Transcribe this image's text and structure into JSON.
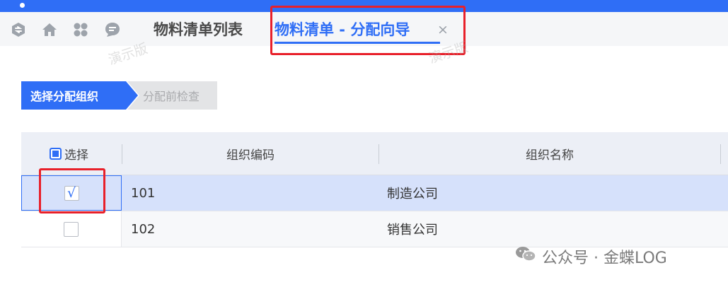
{
  "header": {
    "icons": [
      "refresh-icon",
      "home-icon",
      "apps-icon",
      "chat-icon"
    ],
    "tabs": [
      {
        "label": "物料清单列表",
        "active": false
      },
      {
        "label": "物料清单 - 分配向导",
        "active": true,
        "closable": true,
        "close_label": "×"
      }
    ]
  },
  "watermark": "演示版",
  "wizard": {
    "steps": [
      {
        "label": "选择分配组织",
        "active": true
      },
      {
        "label": "分配前检查",
        "active": false
      }
    ]
  },
  "grid": {
    "columns": {
      "select": "选择",
      "code": "组织编码",
      "name": "组织名称"
    },
    "rows": [
      {
        "selected": true,
        "check": "√",
        "code": "101",
        "name": "制造公司"
      },
      {
        "selected": false,
        "check": "",
        "code": "102",
        "name": "销售公司"
      }
    ]
  },
  "footer": {
    "brand": "公众号 · 金蝶LOG"
  },
  "colors": {
    "accent": "#2f6ef6",
    "highlight": "#e8202a",
    "selected_row": "#d6e1fb"
  }
}
